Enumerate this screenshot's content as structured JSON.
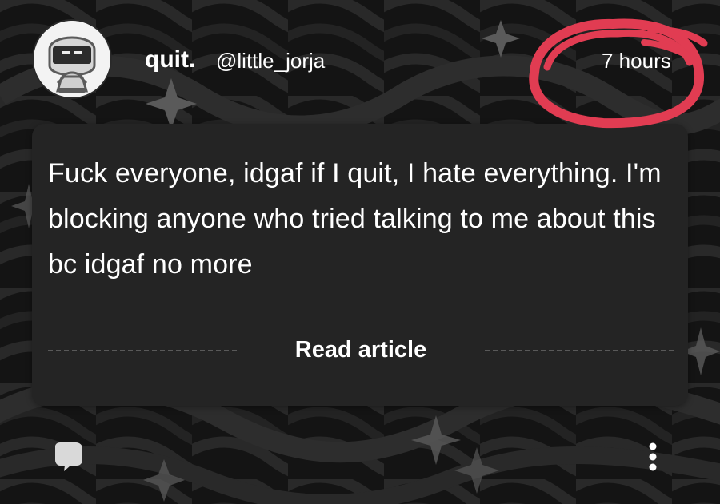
{
  "post": {
    "display_name": "quit.",
    "username": "@little_jorja",
    "timestamp": "7 hours",
    "body": "Fuck everyone, idgaf if I quit, I hate everything. I'm blocking anyone who tried talking to me about this bc idgaf no more",
    "read_article_label": "Read article"
  },
  "icons": {
    "comment": "comment-icon",
    "more": "more-options-icon",
    "avatar": "hooded-character-avatar"
  },
  "colors": {
    "background": "#121212",
    "card": "#242424",
    "text": "#ffffff",
    "annotation_circle": "#e13c52"
  }
}
